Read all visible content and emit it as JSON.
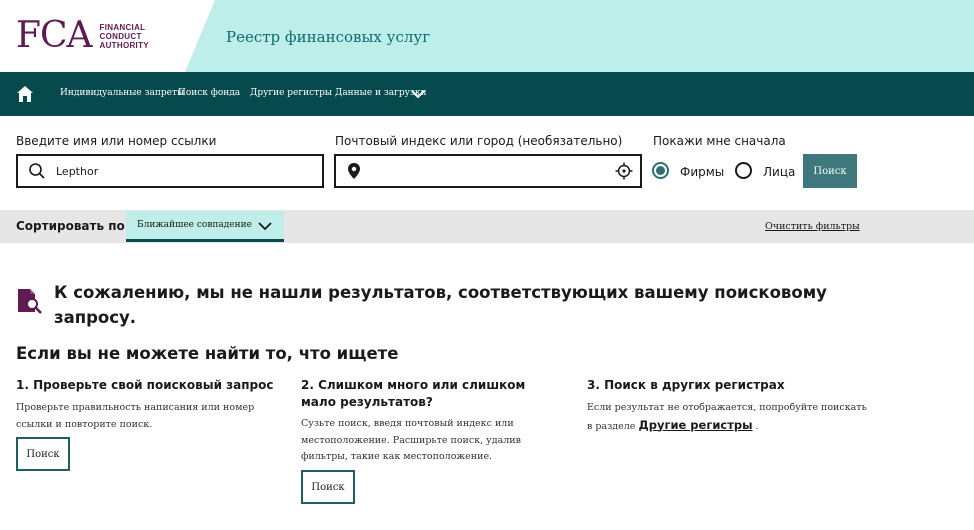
{
  "header": {
    "logo_mark": "FCA",
    "logo_lines": [
      "FINANCIAL",
      "CONDUCT",
      "AUTHORITY"
    ],
    "app_title": "Реестр финансовых услуг"
  },
  "nav": {
    "items": [
      {
        "label": "Индивидуальные запреты"
      },
      {
        "label": "Поиск фонда"
      },
      {
        "label": "Другие регистры"
      },
      {
        "label": "Данные и загрузки"
      }
    ]
  },
  "search": {
    "name_label": "Введите имя или номер ссылки",
    "name_value": "Lepthor",
    "location_label": "Почтовый индекс или город (необязательно)",
    "location_value": "",
    "show_first_label": "Покажи мне сначала",
    "options": [
      {
        "label": "Фирмы",
        "checked": true
      },
      {
        "label": "Лица",
        "checked": false
      }
    ],
    "submit_label": "Поиск"
  },
  "sort": {
    "label": "Сортировать по",
    "selected": "Ближайшее совпадение",
    "clear_label": "Очистить фильтры"
  },
  "results": {
    "no_results_title": "К сожалению, мы не нашли результатов, соответствующих вашему поисковому запросу.",
    "help_heading": "Если вы не можете найти то, что ищете",
    "columns": [
      {
        "title": "1. Проверьте свой поисковый запрос",
        "text": "Проверьте правильность написания или номер ссылки и повторите поиск.",
        "button": "Поиск"
      },
      {
        "title": "2. Слишком много или слишком мало результатов?",
        "text": "Сузьте поиск, введя почтовый индекс или местоположение. Расширьте поиск, удалив фильтры, такие как местоположение.",
        "button": "Поиск"
      },
      {
        "title": "3. Поиск в других регистрах",
        "text_before": "Если результат не отображается, попробуйте поискать в разделе",
        "link": "Другие регистры",
        "text_after": "."
      }
    ]
  },
  "colors": {
    "brand": "#5f1b52",
    "nav_bg": "#064a4e",
    "header_teal": "#bdeeea",
    "button_teal": "#3f787c"
  }
}
